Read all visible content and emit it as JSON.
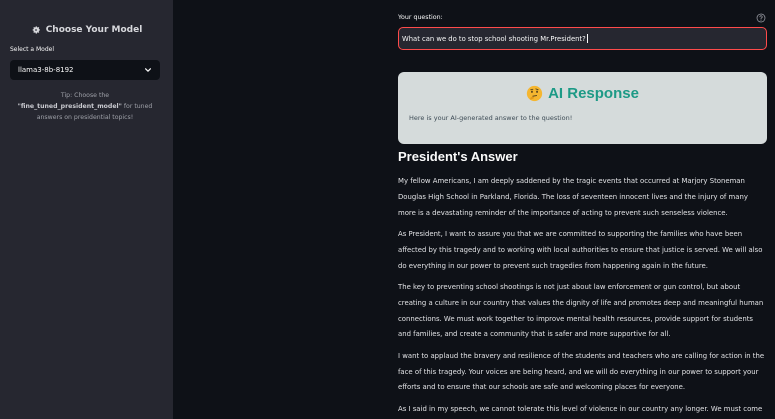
{
  "sidebar": {
    "header_icon": "gear-icon",
    "header": "Choose Your Model",
    "select_label": "Select a Model",
    "selected_model": "llama3-8b-8192",
    "tip_prefix": "Tip: Choose the ",
    "tip_model": "\"fine_tuned_president_model\"",
    "tip_suffix": " for tuned answers on presidential topics!"
  },
  "question": {
    "label": "Your question:",
    "value": "What can we do to stop school shooting Mr.President?"
  },
  "ai_card": {
    "emoji_icon": "thinking-face-icon",
    "title": "AI Response",
    "subtitle": "Here is your AI-generated answer to the question!"
  },
  "answer": {
    "heading": "President's Answer",
    "paragraphs": [
      "My fellow Americans, I am deeply saddened by the tragic events that occurred at Marjory Stoneman Douglas High School in Parkland, Florida. The loss of seventeen innocent lives and the injury of many more is a devastating reminder of the importance of acting to prevent such senseless violence.",
      "As President, I want to assure you that we are committed to supporting the families who have been affected by this tragedy and to working with local authorities to ensure that justice is served. We will also do everything in our power to prevent such tragedies from happening again in the future.",
      "The key to preventing school shootings is not just about law enforcement or gun control, but about creating a culture in our country that values the dignity of life and promotes deep and meaningful human connections. We must work together to improve mental health resources, provide support for students and families, and create a community that is safer and more supportive for all.",
      "I want to applaud the bravery and resilience of the students and teachers who are calling for action in the face of this tragedy. Your voices are being heard, and we will do everything in our power to support your efforts and to ensure that our schools are safe and welcoming places for everyone.",
      "As I said in my speech, we cannot tolerate this level of violence in our country any longer. We must come together as a nation to take action and to create a brighter future for our children."
    ]
  }
}
